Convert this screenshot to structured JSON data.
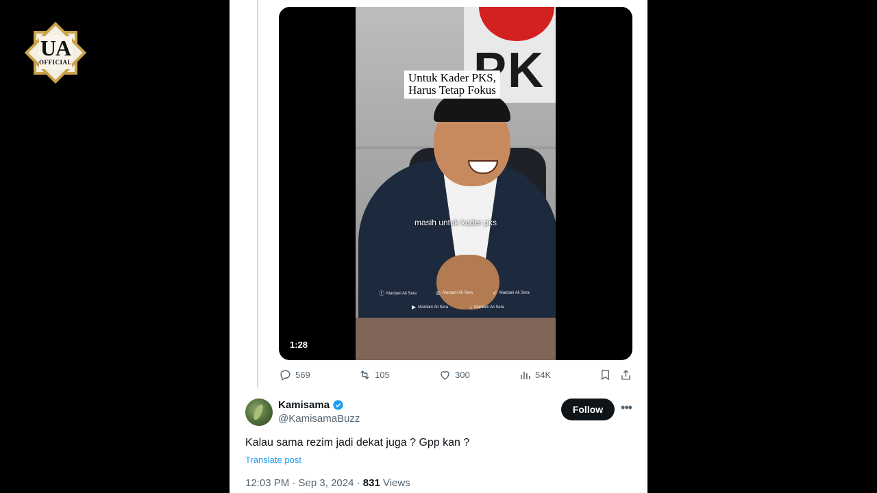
{
  "channel_logo": {
    "line1": "UA",
    "line2": "OFFICIAL"
  },
  "video": {
    "title_line1": "Untuk Kader PKS,",
    "title_line2": "Harus Tetap Fokus",
    "background_sign": "PK",
    "subtitle": "masih untuk kader pks",
    "duration": "1:28",
    "watermarks": [
      {
        "icon": "facebook-icon",
        "label": "Mardani Ali Sera"
      },
      {
        "icon": "instagram-icon",
        "label": "Mardani Ali Sera"
      },
      {
        "icon": "twitter-icon",
        "label": "Mardani Ali Sera"
      },
      {
        "icon": "youtube-icon",
        "label": "Mardani Ali Sera"
      },
      {
        "icon": "tiktok-icon",
        "label": "Mardani Ali Sera"
      }
    ]
  },
  "actions": {
    "replies": "569",
    "reposts": "105",
    "likes": "300",
    "views": "54K"
  },
  "reply": {
    "name": "Kamisama",
    "verified": true,
    "handle": "@KamisamaBuzz",
    "follow_label": "Follow",
    "more_label": "•••",
    "text": "Kalau sama rezim jadi dekat juga ?  Gpp kan ?",
    "translate_label": "Translate post",
    "time": "12:03 PM · Sep 3, 2024 · ",
    "views_count": "831",
    "views_label": " Views"
  },
  "colors": {
    "accent": "#1d9bf0",
    "text_primary": "#0f1419",
    "text_secondary": "#536471"
  }
}
